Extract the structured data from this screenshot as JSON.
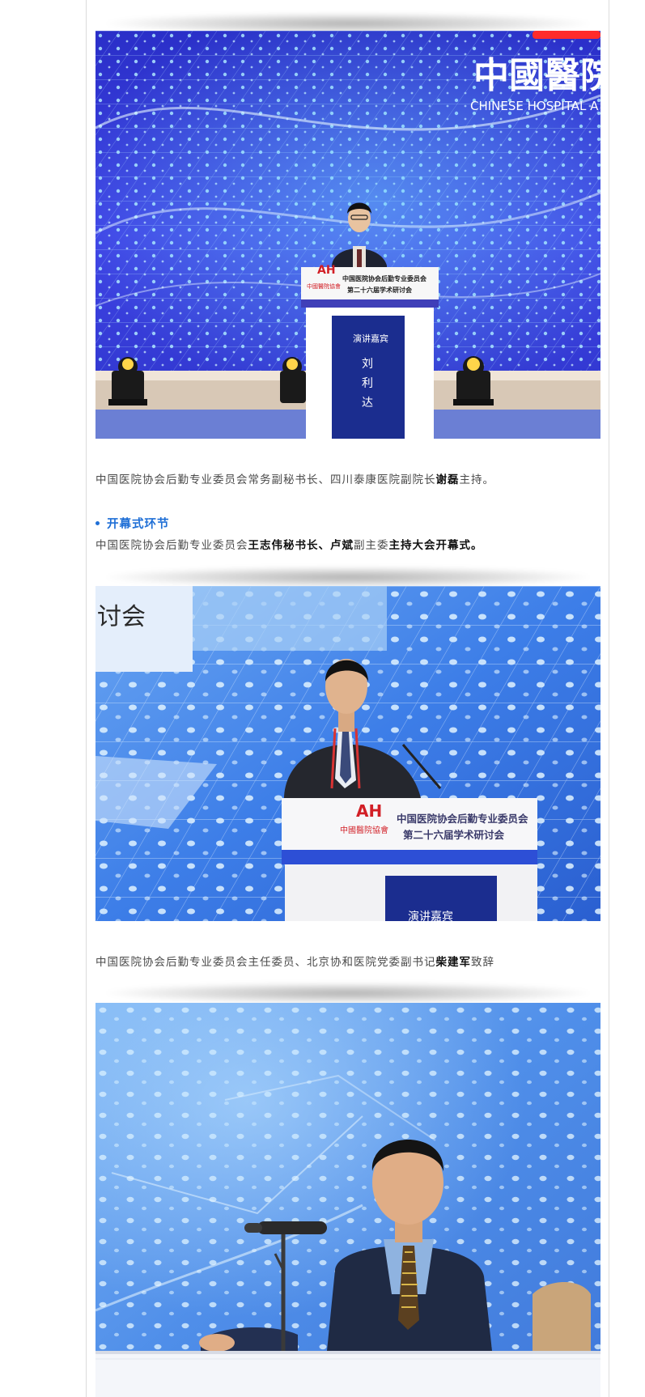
{
  "photos": [
    {
      "watermark_cn": "中國醫院",
      "watermark_en": "CHINESE HOSPITAL A",
      "podium_title_1": "中国医院协会后勤专业委员会",
      "podium_title_2": "第二十六届学术研讨会",
      "podium_logo": "中國醫院協會",
      "podium_panel_label": "演讲嘉宾",
      "podium_name_1": "刘",
      "podium_name_2": "利",
      "podium_name_3": "达"
    },
    {
      "screen_text": "讨会",
      "podium_title_1": "中国医院协会后勤专业委员会",
      "podium_title_2": "第二十六届学术研讨会",
      "podium_logo": "中國醫院協會",
      "podium_panel_label": "演讲嘉宾"
    },
    {}
  ],
  "caption1": {
    "before": "中国医院协会后勤专业委员会常务副秘书长、四川泰康医院副院长",
    "bold": "谢磊",
    "after": "主持。"
  },
  "section": {
    "heading": "开幕式环节"
  },
  "caption2": {
    "before": "中国医院协会后勤专业委员会",
    "bold1": "王志伟秘书长",
    "mid1": "、",
    "bold2": "卢斌",
    "mid2": "副主委",
    "bold3": "主持大会开幕式",
    "after": "。"
  },
  "caption3": {
    "before": "中国医院协会后勤专业委员会主任委员、北京协和医院党委副书记",
    "bold": "柴建军",
    "after": "致辞"
  },
  "colors": {
    "accent": "#1f6fd6",
    "stage_blue": "#3b3ee0",
    "podium_blue": "#1b2d8f",
    "screen_light": "#5b97ee"
  }
}
